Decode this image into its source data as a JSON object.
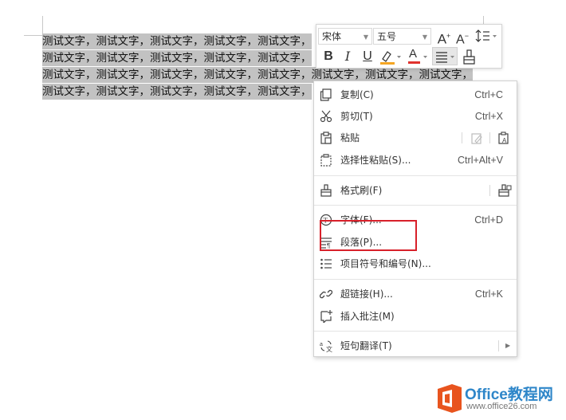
{
  "document": {
    "line1": "测试文字，测试文字，测试文字，测试文字，测试文字，",
    "line2": "测试文字，测试文字，测试文字，测试文字，测试文字，",
    "line3": "测试文字，测试文字，测试文字，测试文字，测试文字，测试文字，测试文字，测试文字，",
    "line4": "测试文字，测试文字，测试文字，测试文字，测试文字，"
  },
  "mini_toolbar": {
    "font_name": "宋体",
    "font_size": "五号",
    "grow_font": "A",
    "shrink_font": "A",
    "bold": "B",
    "italic": "I",
    "underline": "U",
    "font_color_letter": "A",
    "highlight_color": "#f5a623",
    "font_color": "#e0322d"
  },
  "context_menu": {
    "copy": {
      "label": "复制(C)",
      "shortcut": "Ctrl+C"
    },
    "cut": {
      "label": "剪切(T)",
      "shortcut": "Ctrl+X"
    },
    "paste": {
      "label": "粘贴"
    },
    "paste_special": {
      "label": "选择性粘贴(S)...",
      "shortcut": "Ctrl+Alt+V"
    },
    "format_painter": {
      "label": "格式刷(F)"
    },
    "font": {
      "label": "字体(F)...",
      "shortcut": "Ctrl+D"
    },
    "paragraph": {
      "label": "段落(P)..."
    },
    "bullets": {
      "label": "项目符号和编号(N)..."
    },
    "hyperlink": {
      "label": "超链接(H)...",
      "shortcut": "Ctrl+K"
    },
    "insert_comment": {
      "label": "插入批注(M)"
    },
    "translate": {
      "label": "短句翻译(T)"
    }
  },
  "watermark": {
    "text": "Office教程网",
    "url": "www.office26.com"
  },
  "colors": {
    "selection": "#c2c2c2",
    "highlight_box": "#d8202a",
    "watermark_orange": "#e8541e",
    "watermark_blue": "#2e86c9"
  }
}
